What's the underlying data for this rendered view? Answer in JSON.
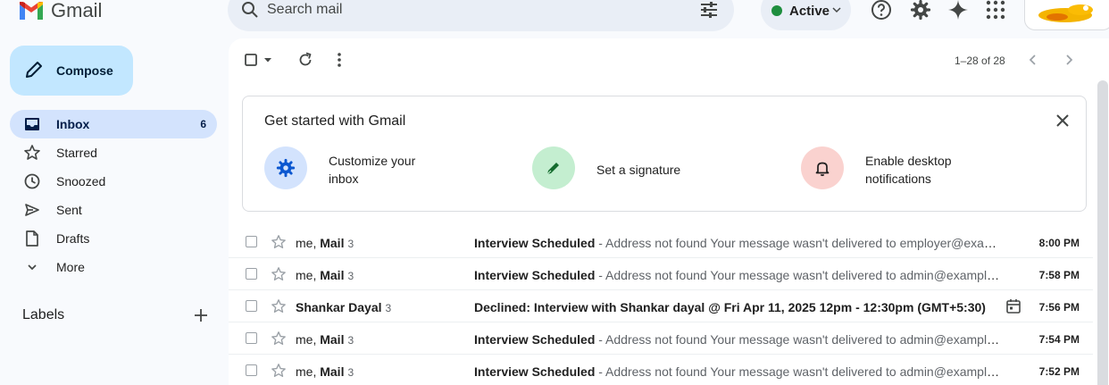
{
  "app": {
    "name": "Gmail"
  },
  "search": {
    "placeholder": "Search mail"
  },
  "status": {
    "label": "Active",
    "color": "#1e8e3e"
  },
  "header_icons": [
    "help-icon",
    "settings-icon",
    "gemini-icon",
    "apps-icon"
  ],
  "compose": {
    "label": "Compose"
  },
  "nav": [
    {
      "label": "Inbox",
      "count": "6",
      "icon": "inbox-icon",
      "active": true
    },
    {
      "label": "Starred",
      "count": "",
      "icon": "star-icon"
    },
    {
      "label": "Snoozed",
      "count": "",
      "icon": "clock-icon"
    },
    {
      "label": "Sent",
      "count": "",
      "icon": "send-icon"
    },
    {
      "label": "Drafts",
      "count": "",
      "icon": "draft-icon"
    },
    {
      "label": "More",
      "count": "",
      "icon": "chevron-down-icon"
    }
  ],
  "labels": {
    "title": "Labels"
  },
  "toolbar": {
    "pagination": "1–28 of 28"
  },
  "get_started": {
    "title": "Get started with Gmail",
    "tips": [
      {
        "label": "Customize your inbox",
        "icon": "settings-icon",
        "color": "#d3e3fd"
      },
      {
        "label": "Set a signature",
        "icon": "pen-icon",
        "color": "#c4eed0"
      },
      {
        "label": "Enable desktop notifications",
        "icon": "bell-icon",
        "color": "#fad2cf"
      }
    ]
  },
  "emails": [
    {
      "sender_pre": "me, ",
      "sender_bold": "Mail",
      "count": "3",
      "subject": "Interview Scheduled",
      "snippet": " - Address not found Your message wasn't delivered to employer@example.com",
      "time": "8:00 PM",
      "calendar": false
    },
    {
      "sender_pre": "me, ",
      "sender_bold": "Mail",
      "count": "3",
      "subject": "Interview Scheduled",
      "snippet": " - Address not found Your message wasn't delivered to admin@example.com",
      "time": "7:58 PM",
      "calendar": false
    },
    {
      "sender_pre": "",
      "sender_bold": "Shankar Dayal",
      "count": "3",
      "subject": "Declined: Interview with Shankar dayal @ Fri Apr 11, 2025 12pm - 12:30pm (GMT+5:30)",
      "snippet": "",
      "time": "7:56 PM",
      "calendar": true
    },
    {
      "sender_pre": "me, ",
      "sender_bold": "Mail",
      "count": "3",
      "subject": "Interview Scheduled",
      "snippet": " - Address not found Your message wasn't delivered to admin@example.com",
      "time": "7:54 PM",
      "calendar": false
    },
    {
      "sender_pre": "me, ",
      "sender_bold": "Mail",
      "count": "3",
      "subject": "Interview Scheduled",
      "snippet": " - Address not found Your message wasn't delivered to admin@example.com",
      "time": "7:52 PM",
      "calendar": false
    }
  ]
}
